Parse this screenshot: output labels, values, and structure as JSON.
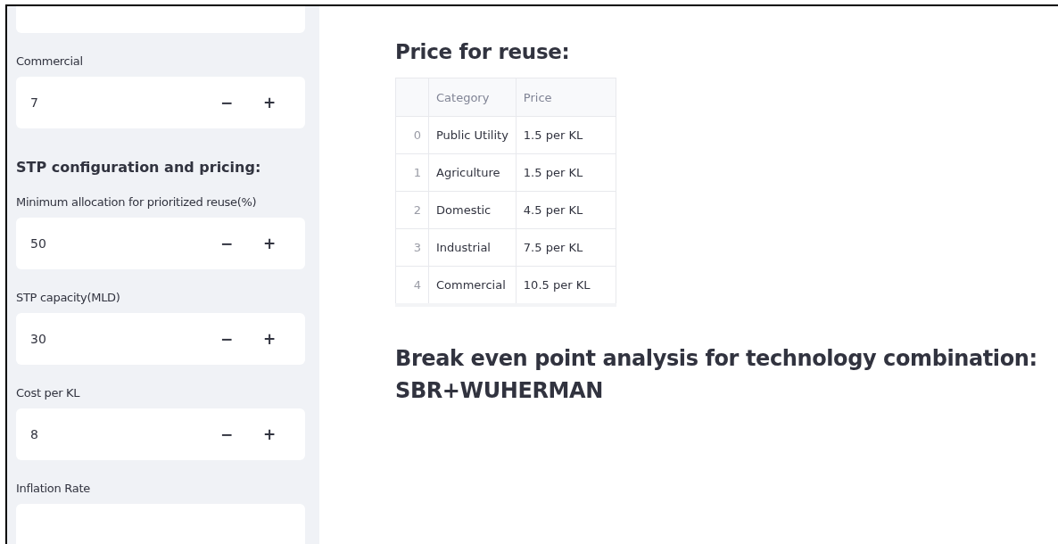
{
  "sidebar": {
    "items": [
      {
        "kind": "number_input"
      },
      {
        "kind": "number_input",
        "label": "Commercial",
        "value": "7",
        "decrement": "−",
        "increment": "+"
      },
      {
        "kind": "heading",
        "text": "STP configuration and pricing:"
      },
      {
        "kind": "number_input",
        "label": "Minimum allocation for prioritized reuse(%)",
        "value": "50",
        "decrement": "−",
        "increment": "+"
      },
      {
        "kind": "number_input",
        "label": "STP capacity(MLD)",
        "value": "30",
        "decrement": "−",
        "increment": "+"
      },
      {
        "kind": "number_input",
        "label": "Cost per KL",
        "value": "8",
        "decrement": "−",
        "increment": "+"
      },
      {
        "kind": "number_input",
        "label": "Inflation Rate"
      }
    ]
  },
  "main": {
    "sections": [
      {
        "kind": "heading",
        "text": "Price for reuse:"
      },
      {
        "kind": "table",
        "columns": [
          "Category",
          "Price"
        ],
        "rows": [
          {
            "index": "0",
            "cells": [
              "Public Utility",
              "1.5 per KL"
            ]
          },
          {
            "index": "1",
            "cells": [
              "Agriculture",
              "1.5 per KL"
            ]
          },
          {
            "index": "2",
            "cells": [
              "Domestic",
              "4.5 per KL"
            ]
          },
          {
            "index": "3",
            "cells": [
              "Industrial",
              "7.5 per KL"
            ]
          },
          {
            "index": "4",
            "cells": [
              "Commercial",
              "10.5 per KL"
            ]
          }
        ]
      },
      {
        "kind": "big_heading",
        "lines": [
          "Break even point analysis for technology combination:",
          "SBR+WUHERMAN"
        ]
      }
    ]
  }
}
